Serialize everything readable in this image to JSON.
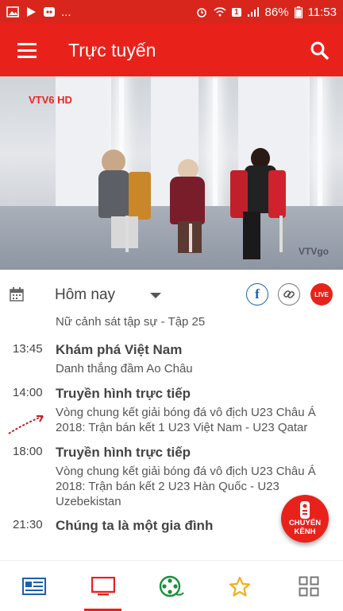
{
  "status_bar": {
    "ellipsis": "...",
    "sim_badge": "1",
    "battery": "86%",
    "time": "11:53"
  },
  "app_bar": {
    "title": "Trực tuyến"
  },
  "video": {
    "channel_logo": "VTV6 HD",
    "watermark": "VTVgo"
  },
  "date_row": {
    "selected_date": "Hôm nay",
    "live_badge": "LIVE"
  },
  "schedule": {
    "partial_item": "Nữ cảnh sát tập sự - Tập 25",
    "items": [
      {
        "time": "13:45",
        "show": "Khám phá Việt Nam",
        "desc": "Danh thắng đầm Ao Châu"
      },
      {
        "time": "14:00",
        "show": "Truyền hình trực tiếp",
        "desc": "Vòng chung kết giải bóng đá vô địch U23 Châu Á 2018: Trận bán kết 1 U23 Việt Nam - U23 Qatar"
      },
      {
        "time": "18:00",
        "show": "Truyền hình trực tiếp",
        "desc": "Vòng chung kết giải bóng đá vô địch U23 Châu Á 2018: Trận bán kết 2 U23 Hàn Quốc - U23 Uzebekistan"
      },
      {
        "time": "21:30",
        "show": "Chúng ta là một gia đình",
        "desc": ""
      }
    ]
  },
  "fab": {
    "label_line1": "CHUYỂN",
    "label_line2": "KÊNH"
  },
  "colors": {
    "brand_red": "#e8221b",
    "status_red": "#d9261c",
    "nav_blue": "#1a5fb4",
    "nav_green": "#1a8f3c",
    "nav_yellow": "#f2b01e"
  }
}
